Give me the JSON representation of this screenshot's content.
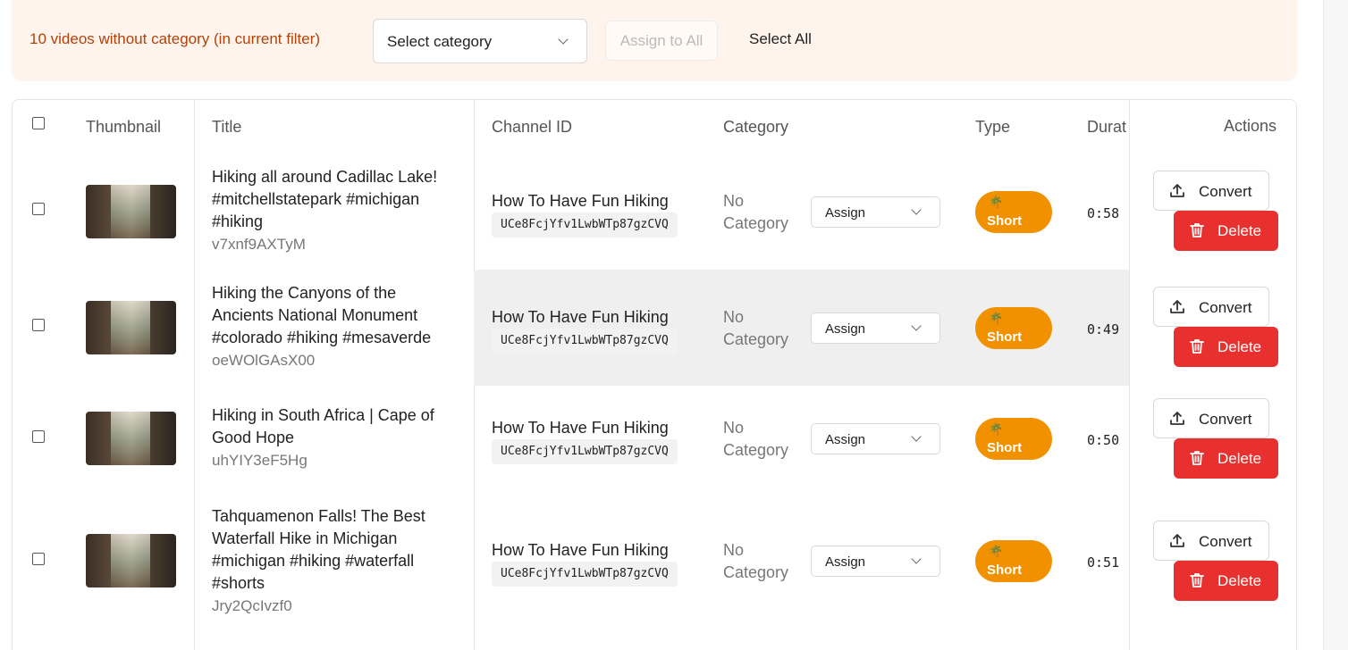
{
  "banner": {
    "message": "10 videos without category (in current filter)",
    "select_value": "Select category",
    "assign_all_label": "Assign to All",
    "select_all_label": "Select All"
  },
  "table": {
    "headers": {
      "thumbnail": "Thumbnail",
      "title": "Title",
      "channel_id": "Channel ID",
      "category": "Category",
      "type": "Type",
      "duration": "Durat",
      "actions": "Actions"
    },
    "rows": [
      {
        "title": "Hiking all around Cadillac Lake! #mitchellstatepark #michigan #hiking",
        "video_id": "v7xnf9AXTyM",
        "channel_name": "How To Have Fun Hiking",
        "channel_id": "UCe8FcjYfv1LwbWTp87gzCVQ",
        "category": "No Category",
        "assign_label": "Assign",
        "type_label": "Short",
        "type_icon": "🌴",
        "duration": "0:58",
        "convert_label": "Convert",
        "delete_label": "Delete"
      },
      {
        "title": "Hiking the Canyons of the Ancients National Monument #colorado #hiking #mesaverde",
        "video_id": "oeWOlGAsX00",
        "channel_name": "How To Have Fun Hiking",
        "channel_id": "UCe8FcjYfv1LwbWTp87gzCVQ",
        "category": "No Category",
        "assign_label": "Assign",
        "type_label": "Short",
        "type_icon": "🌴",
        "duration": "0:49",
        "convert_label": "Convert",
        "delete_label": "Delete"
      },
      {
        "title": "Hiking in South Africa | Cape of Good Hope",
        "video_id": "uhYIY3eF5Hg",
        "channel_name": "How To Have Fun Hiking",
        "channel_id": "UCe8FcjYfv1LwbWTp87gzCVQ",
        "category": "No Category",
        "assign_label": "Assign",
        "type_label": "Short",
        "type_icon": "🌴",
        "duration": "0:50",
        "convert_label": "Convert",
        "delete_label": "Delete"
      },
      {
        "title": "Tahquamenon Falls! The Best Waterfall Hike in Michigan #michigan #hiking #waterfall #shorts",
        "video_id": "Jry2QcIvzf0",
        "channel_name": "How To Have Fun Hiking",
        "channel_id": "UCe8FcjYfv1LwbWTp87gzCVQ",
        "category": "No Category",
        "assign_label": "Assign",
        "type_label": "Short",
        "type_icon": "🌴",
        "duration": "0:51",
        "convert_label": "Convert",
        "delete_label": "Delete"
      }
    ]
  }
}
